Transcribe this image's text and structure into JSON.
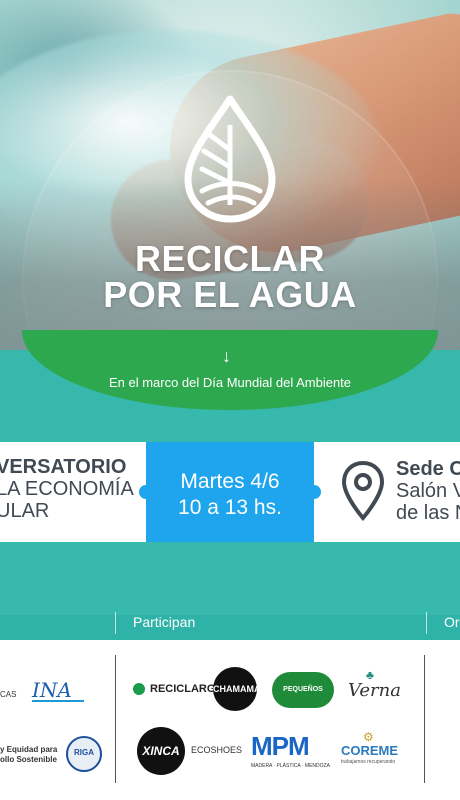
{
  "hero": {
    "title_line1": "RECICLAR",
    "title_line2": "POR EL AGUA"
  },
  "banner": {
    "arrow": "↓",
    "subtitle": "En el marco del Día Mundial del Ambiente"
  },
  "event": {
    "left_lines": [
      "VERSATORIO",
      "LA ECONOMÍA",
      "ULAR"
    ],
    "date": "Martes 4/6",
    "time": "10 a 13 hs.",
    "venue_lines": [
      "Sede C",
      "Salón V",
      "de las N"
    ]
  },
  "participants": {
    "heading": "Participan",
    "right_heading": "Or",
    "left_logos": {
      "cut_text": "CAS",
      "ina": "INA",
      "equidad": "y Equidad para",
      "sostenible": "ollo Sostenible",
      "riga": "RIGA"
    },
    "logos": {
      "reciclarg": "RECICLARG",
      "chamama": "CHAMAMA",
      "pequenos_verdes": "PEQUEÑOS VERDES",
      "verna": "Verna",
      "xinca": "XINCA",
      "ecoshoes": "ECOSHOES",
      "mpm": "MPM",
      "mpm_sub": "MADERA · PLÁSTICA · MENDOZA",
      "coreme": "COREME",
      "coreme_sub": "trabajamos recuperando"
    }
  },
  "colors": {
    "teal": "#38b9ae",
    "green": "#2ea84f",
    "blue": "#1fa5ee",
    "text_dark": "#414a52"
  }
}
